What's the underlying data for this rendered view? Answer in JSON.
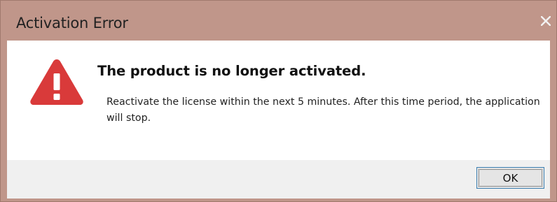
{
  "window": {
    "title": "Activation Error",
    "close_icon": "close-icon"
  },
  "content": {
    "icon": "warning-triangle-icon",
    "heading": "The product is no longer activated.",
    "message": "Reactivate the license within the next 5 minutes. After this time period, the application will stop."
  },
  "footer": {
    "ok_label": "OK"
  },
  "colors": {
    "titlebar": "#c0968a",
    "warning": "#d93a3a",
    "footer": "#f0f0f0",
    "button_border": "#3c7fb1"
  }
}
